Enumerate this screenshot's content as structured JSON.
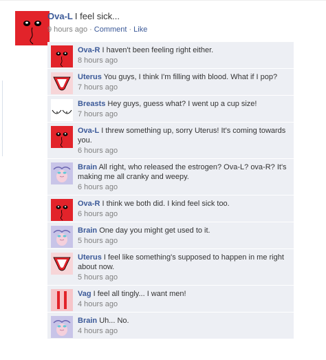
{
  "post": {
    "author": "Ova-L",
    "text": "I feel sick...",
    "time": "9 hours ago",
    "comment_link": "Comment",
    "like_link": "Like",
    "separator": "·"
  },
  "comments": [
    {
      "author": "Ova-R",
      "avatar": "ovary-icon",
      "text": "I haven't been feeling right either.",
      "time": "8 hours ago"
    },
    {
      "author": "Uterus",
      "avatar": "uterus-icon",
      "text": "You guys, I think I'm filling with blood. What if I pop?",
      "time": "7 hours ago"
    },
    {
      "author": "Breasts",
      "avatar": "breasts-icon",
      "text": "Hey guys, guess what? I went up a cup size!",
      "time": "7 hours ago"
    },
    {
      "author": "Ova-L",
      "avatar": "ovary-icon",
      "text": "I threw something up, sorry Uterus! It's coming towards you.",
      "time": "6 hours ago"
    },
    {
      "author": "Brain",
      "avatar": "brain-icon",
      "text": "All right, who released the estrogen? Ova-L? ova-R? It's making me all cranky and weepy.",
      "time": "6 hours ago"
    },
    {
      "author": "Ova-R",
      "avatar": "ovary-icon",
      "text": "I think we both did. I kind feel sick too.",
      "time": "6 hours ago"
    },
    {
      "author": "Brain",
      "avatar": "brain-icon",
      "text": "One day you might get used to it.",
      "time": "5 hours ago"
    },
    {
      "author": "Uterus",
      "avatar": "uterus-icon",
      "text": "I feel like something's supposed to happen in me right about now.",
      "time": "5 hours ago"
    },
    {
      "author": "Vag",
      "avatar": "vag-icon",
      "text": "I feel all tingly... I want men!",
      "time": "4 hours ago"
    },
    {
      "author": "Brain",
      "avatar": "brain-icon",
      "text": "Uh... No.",
      "time": "4 hours ago"
    }
  ],
  "colors": {
    "link": "#3b5998",
    "comment_bg": "#edeff4",
    "ovary_red": "#e2232a",
    "uterus_bg": "#f7d5d8",
    "brain_bg": "#c8c4e8",
    "vag_bg": "#f6c5c9"
  }
}
